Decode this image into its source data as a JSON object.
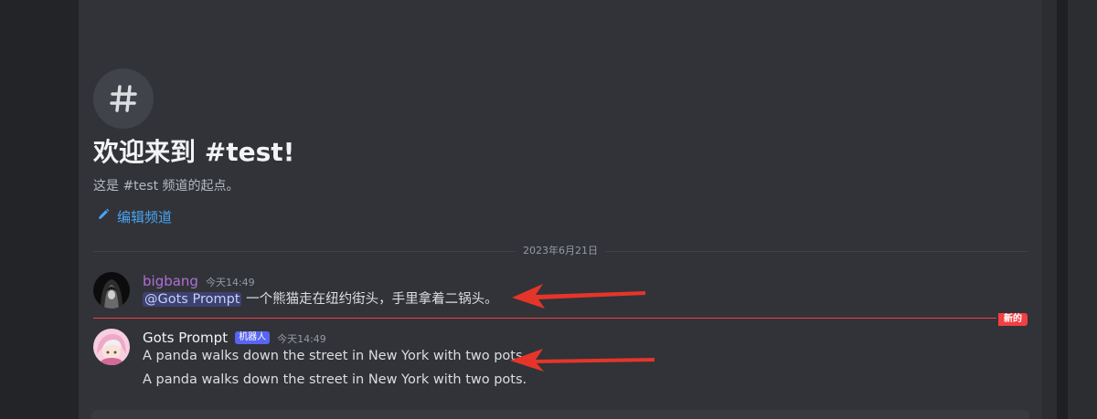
{
  "welcome": {
    "icon": "hash-icon",
    "title": "欢迎来到 #test!",
    "subtitle": "这是 #test 频道的起点。",
    "edit_label": "编辑频道",
    "edit_icon": "pencil-icon"
  },
  "date_divider": "2023年6月21日",
  "messages": [
    {
      "username": "bigbang",
      "username_color": "#b06fd6",
      "timestamp": "今天14:49",
      "mention": "@Gots Prompt",
      "text": "一个熊猫走在纽约街头，手里拿着二锅头。"
    },
    {
      "username": "Gots Prompt",
      "username_color": "#f2f3f5",
      "badge": "机器人",
      "timestamp": "今天14:49",
      "lines": [
        "A panda walks down the street in New York with two pots.",
        "A panda walks down the street in New York with two pots."
      ]
    }
  ],
  "new_divider_label": "新的",
  "colors": {
    "background": "#313338",
    "link": "#4aa3f0",
    "new_marker": "#f23f43",
    "bot_badge": "#5865f2",
    "arrow": "#e5352a"
  }
}
